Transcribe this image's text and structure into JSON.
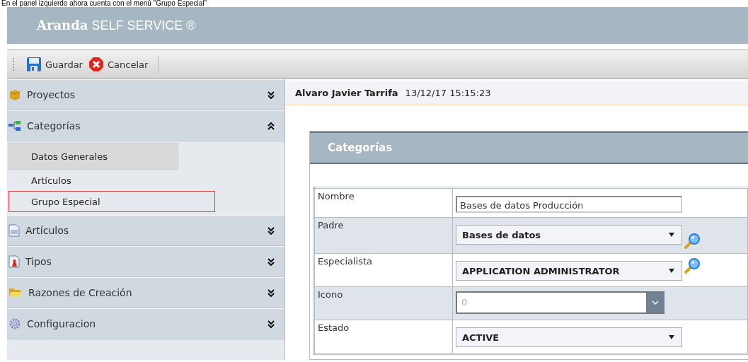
{
  "caption": "En el panel izquierdo ahora cuenta con el menú \"Grupo Especial\"",
  "app": {
    "brand_bold": "Aranda",
    "brand_rest": "SELF SERVICE ®"
  },
  "toolbar": [
    {
      "label": "Guardar",
      "kind": "save"
    },
    {
      "label": "Cancelar",
      "kind": "cancel"
    }
  ],
  "sidebar": {
    "items": [
      {
        "label": "Proyectos",
        "expanded": false
      },
      {
        "label": "Categorías",
        "expanded": true,
        "children": [
          {
            "label": "Datos Generales",
            "selected": true,
            "highlighted": false
          },
          {
            "label": "Artículos",
            "selected": false,
            "highlighted": false
          },
          {
            "label": "Grupo Especial",
            "selected": false,
            "highlighted": true
          }
        ]
      },
      {
        "label": "Artículos",
        "expanded": false
      },
      {
        "label": "Tipos",
        "expanded": false
      },
      {
        "label": "Razones de Creación",
        "expanded": false
      },
      {
        "label": "Configuracion",
        "expanded": false
      }
    ]
  },
  "user_bar": {
    "user": "Alvaro Javier Tarrifa",
    "timestamp": "13/12/17 15:15:23"
  },
  "panel": {
    "title": "Categorías",
    "fields": [
      {
        "label": "Nombre",
        "kind": "text",
        "value": "Bases de datos Producción",
        "disabled": false,
        "search": false
      },
      {
        "label": "Padre",
        "kind": "select",
        "value": "Bases de datos",
        "disabled": false,
        "search": true
      },
      {
        "label": "Especialista",
        "kind": "select",
        "value": "APPLICATION ADMINISTRATOR",
        "disabled": false,
        "search": true
      },
      {
        "label": "Icono",
        "kind": "combo",
        "value": "0",
        "disabled": true,
        "search": false
      },
      {
        "label": "Estado",
        "kind": "select",
        "value": "ACTIVE",
        "disabled": false,
        "search": false
      }
    ]
  }
}
